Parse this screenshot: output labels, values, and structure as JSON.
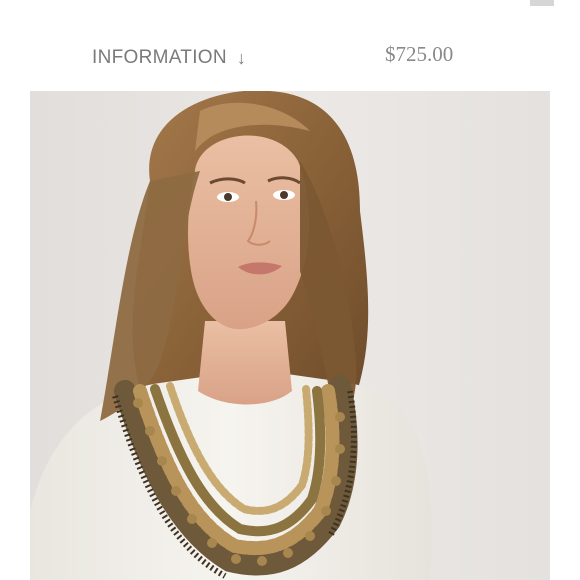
{
  "header": {
    "top_clipped_text": "ᐟ                                     y"
  },
  "product": {
    "info_label": "INFORMATION",
    "info_arrow": "↓",
    "price": "$725.00"
  },
  "image": {
    "subject": "product-photo-model-necklace"
  }
}
